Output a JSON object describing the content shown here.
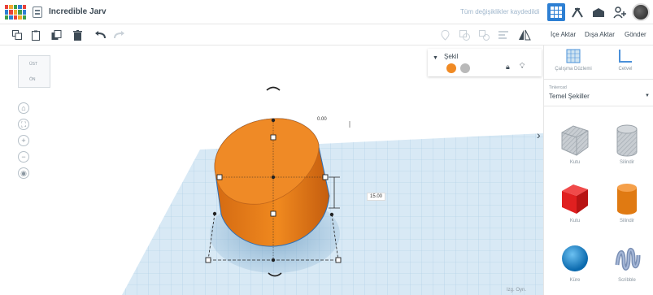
{
  "header": {
    "title": "Incredible Jarv",
    "save_status": "Tüm değişiklikler kaydedildi"
  },
  "toolbar": {
    "import_label": "İçe Aktar",
    "export_label": "Dışa Aktar",
    "send_label": "Gönder"
  },
  "inspector": {
    "label": "Şekil",
    "solid_color": "#f08a24",
    "hole_color": "#b9b9b9"
  },
  "viewport": {
    "viewcube_top": "ÜST",
    "viewcube_front": "ÖN",
    "rotation_value": "0.00",
    "height_value": "15.00",
    "snap_label": "Izg. Oyn."
  },
  "panel": {
    "workplane_label": "Çalışma Düzlemi",
    "ruler_label": "Cetvel",
    "library_owner": "Tinkercad",
    "library_name": "Temel Şekiller",
    "shapes": [
      {
        "name": "Kutu",
        "icon": "hole-box-icon"
      },
      {
        "name": "Silindir",
        "icon": "hole-cylinder-icon"
      },
      {
        "name": "Kutu",
        "icon": "box-icon"
      },
      {
        "name": "Silindir",
        "icon": "cylinder-icon"
      },
      {
        "name": "Küre",
        "icon": "sphere-icon"
      },
      {
        "name": "Scribble",
        "icon": "scribble-icon"
      }
    ]
  },
  "colors": {
    "accent": "#2d7fd3",
    "shape_orange": "#f08a24",
    "grid_blue": "#cfe3f1"
  }
}
